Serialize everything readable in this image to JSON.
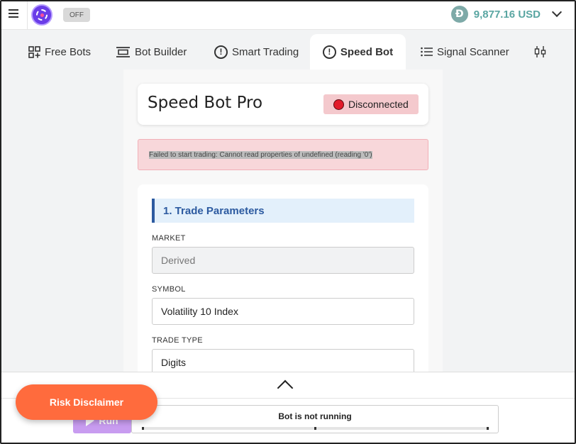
{
  "header": {
    "toggle_label": "OFF",
    "balance_icon_letter": "Đ",
    "balance": "9,877.16 USD"
  },
  "tabs": [
    {
      "label": "Free Bots",
      "icon": "grid-plus-icon"
    },
    {
      "label": "Bot Builder",
      "icon": "builder-icon"
    },
    {
      "label": "Smart Trading",
      "icon": "alert-circle-icon"
    },
    {
      "label": "Speed Bot",
      "icon": "alert-circle-icon",
      "active": true
    },
    {
      "label": "Signal Scanner",
      "icon": "list-icon"
    },
    {
      "label": "",
      "icon": "candlestick-icon"
    }
  ],
  "speed_bot": {
    "title": "Speed Bot Pro",
    "connection_status": "Disconnected",
    "error_message": "Failed to start trading: Cannot read properties of undefined (reading '0')"
  },
  "form": {
    "section_title": "1. Trade Parameters",
    "market_label": "MARKET",
    "market_value": "Derived",
    "symbol_label": "SYMBOL",
    "symbol_value": "Volatility 10 Index",
    "trade_type_label": "TRADE TYPE",
    "trade_type_value": "Digits"
  },
  "bottom": {
    "run_label": "Run",
    "bot_status": "Bot is not running",
    "risk_disclaimer": "Risk Disclaimer"
  },
  "colors": {
    "accent_orange": "#ff6b3d",
    "status_red": "#e21b2a",
    "section_blue": "#2c5aa0",
    "balance_teal": "#5aa6a2"
  }
}
